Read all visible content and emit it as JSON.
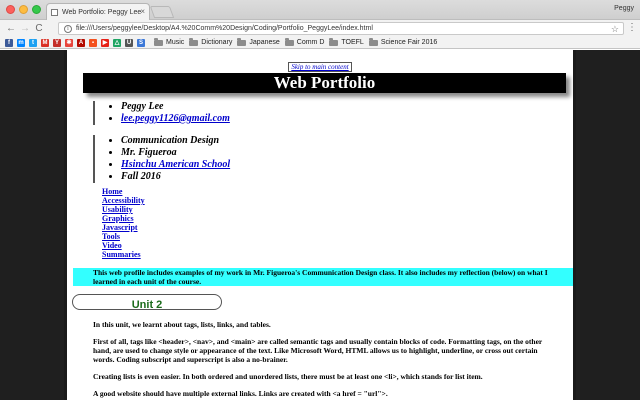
{
  "window": {
    "tab_title": "Web Portfolio: Peggy Lee",
    "tab_close": "×",
    "profile_name": "Peggy"
  },
  "toolbar": {
    "back": "←",
    "forward": "→",
    "reload": "C",
    "url": "file:///Users/peggylee/Desktop/A4.%20Comm%20Design/Coding/Portfolio_PeggyLee/index.html",
    "star": "☆",
    "menu": "⋮"
  },
  "bookmarks": {
    "icons": [
      {
        "name": "facebook-icon",
        "color": "#3b5998",
        "glyph": "f"
      },
      {
        "name": "messenger-icon",
        "color": "#0084ff",
        "glyph": "m"
      },
      {
        "name": "twitter-icon",
        "color": "#1da1f2",
        "glyph": "t"
      },
      {
        "name": "gmail-icon",
        "color": "#d93025",
        "glyph": "M"
      },
      {
        "name": "youtube-icon",
        "color": "#c4302b",
        "glyph": "Y"
      },
      {
        "name": "pinwheel-icon",
        "color": "#e8453c",
        "glyph": "✱"
      },
      {
        "name": "acrobat-icon",
        "color": "#b30b00",
        "glyph": "A"
      },
      {
        "name": "bookmark-icon",
        "color": "#f4511e",
        "glyph": "▪"
      },
      {
        "name": "play-icon",
        "color": "#e62117",
        "glyph": "▶"
      },
      {
        "name": "google-drive-icon",
        "color": "#1fa463",
        "glyph": "△"
      },
      {
        "name": "shield-icon",
        "color": "#555555",
        "glyph": "U"
      },
      {
        "name": "extension-icon",
        "color": "#3c78d8",
        "glyph": "S"
      }
    ],
    "folders": [
      "Music",
      "Dictionary",
      "Japanese",
      "Comm D",
      "TOEFL",
      "Science Fair 2016"
    ]
  },
  "page": {
    "skip_link": "Skip to main content",
    "title": "Web Portfolio",
    "author": {
      "name": "Peggy Lee",
      "email": "lee.peggy1126@gmail.com"
    },
    "course": {
      "subject": "Communication Design",
      "teacher": "Mr. Figueroa",
      "school": "Hsinchu American School",
      "term": "Fall 2016"
    },
    "nav": [
      "Home",
      "Accessibility",
      "Usability",
      "Graphics",
      "Javascript",
      "Tools",
      "Video",
      "Summaries"
    ],
    "intro": "This web profile includes examples of my work in Mr. Figueroa's Communication Design class. It also includes my reflection (below) on what I learned in each unit of the course.",
    "unit_title": "Unit 2",
    "paragraphs": [
      "In this unit, we learnt about tags, lists, links, and tables.",
      "First of all, tags like <header>, <nav>, and <main> are called semantic tags and usually contain blocks of code. Formatting tags, on the other hand, are used to change style or appearance of the text. Like Microsoft Word, HTML allows us to highlight, underline, or cross out certain words. Coding subscript and superscript is also a no-brainer.",
      "Creating lists is even easier. In both ordered and unordered lists, there must be at least one <li>, which stands for list item.",
      "A good website should have multiple external links. Links are created with <a href = \"url\">."
    ]
  }
}
